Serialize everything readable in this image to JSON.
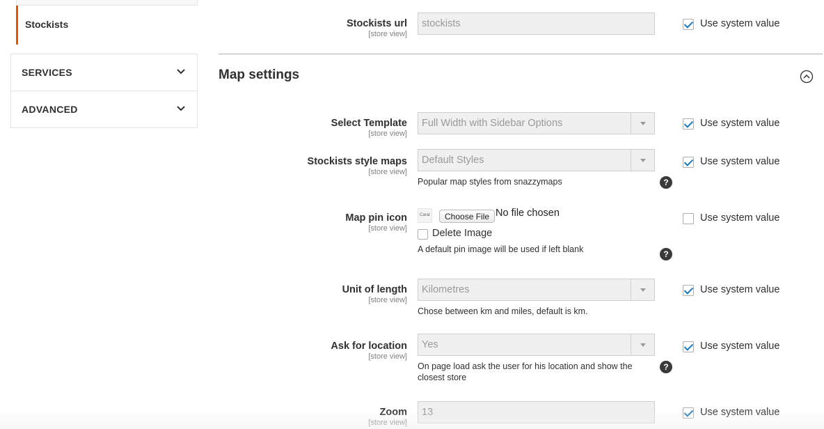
{
  "sidebar": {
    "active_item": "Stockists",
    "sections": [
      {
        "label": "SERVICES",
        "icon": "chevron-down-icon"
      },
      {
        "label": "ADVANCED",
        "icon": "chevron-down-icon"
      }
    ]
  },
  "section": {
    "title": "Map settings",
    "collapse_icon": "chevron-up-circle-icon"
  },
  "system_value_label": "Use system value",
  "fields": {
    "stockists_url": {
      "label": "Stockists url",
      "scope": "[store view]",
      "value": "stockists",
      "use_system": true
    },
    "select_template": {
      "label": "Select Template",
      "scope": "[store view]",
      "value": "Full Width with Sidebar Options",
      "use_system": true
    },
    "style_maps": {
      "label": "Stockists style maps",
      "scope": "[store view]",
      "value": "Default Styles",
      "note": "Popular map styles from snazzymaps",
      "use_system": true
    },
    "map_pin": {
      "label": "Map pin icon",
      "scope": "[store view]",
      "button": "Choose File",
      "status": "No file chosen",
      "thumb": "Carat",
      "delete_label": "Delete Image",
      "note": "A default pin image will be used if left blank",
      "use_system": false
    },
    "unit": {
      "label": "Unit of length",
      "scope": "[store view]",
      "value": "Kilometres",
      "note": "Chose between km and miles, default is km.",
      "use_system": true
    },
    "ask_location": {
      "label": "Ask for location",
      "scope": "[store view]",
      "value": "Yes",
      "note": "On page load ask the user for his location and show the closest store",
      "use_system": true
    },
    "zoom": {
      "label": "Zoom",
      "scope": "[store view]",
      "value": "13",
      "use_system": true
    }
  },
  "help_glyph": "?",
  "colors": {
    "accent": "#eb5202",
    "checkbox": "#1979c3",
    "text": "#303030",
    "disabled_input": "#f0f0f0"
  }
}
